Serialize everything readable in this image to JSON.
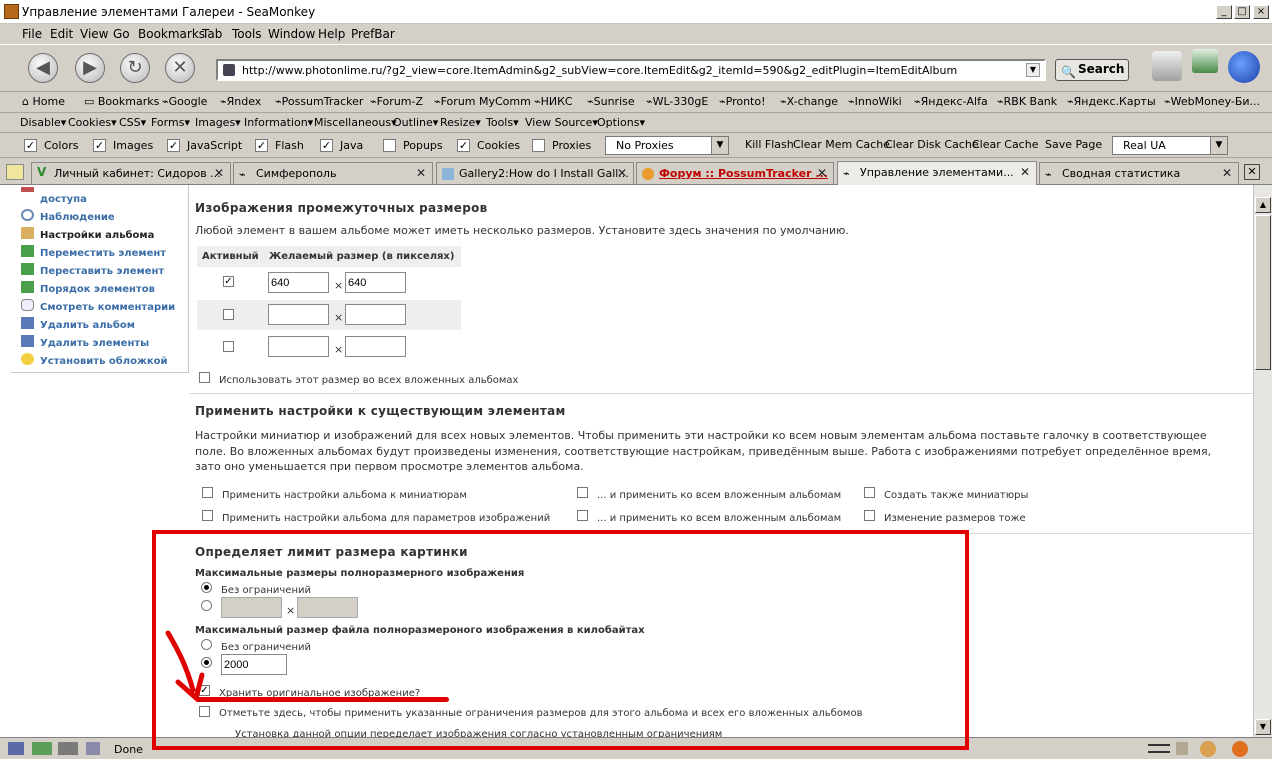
{
  "window": {
    "title": "Управление элементами Галереи - SeaMonkey"
  },
  "menu": [
    "File",
    "Edit",
    "View",
    "Go",
    "Bookmarks",
    "Tab",
    "Tools",
    "Window",
    "Help",
    "PrefBar"
  ],
  "nav": {
    "url": "http://www.photonlime.ru/?g2_view=core.ItemAdmin&g2_subView=core.ItemEdit&g2_itemId=590&g2_editPlugin=ItemEditAlbum",
    "search_label": "Search"
  },
  "bookmarks": [
    "Home",
    "Bookmarks",
    "Google",
    "Яndex",
    "PossumTracker",
    "Forum-Z",
    "Forum MyComm",
    "НИКС",
    "Sunrise",
    "WL-330gE",
    "Pronto!",
    "X-change",
    "InnoWiki",
    "Яндекс-Alfa",
    "RBK Bank",
    "Яндекс.Карты",
    "WebMoney-Би..."
  ],
  "devtools": [
    "Disable▾",
    "Cookies▾",
    "CSS▾",
    "Forms▾",
    "Images▾",
    "Information▾",
    "Miscellaneous▾",
    "Outline▾",
    "Resize▾",
    "Tools▾",
    "View Source▾",
    "Options▾"
  ],
  "prefbar": {
    "checks": [
      {
        "label": "Colors",
        "checked": true
      },
      {
        "label": "Images",
        "checked": true
      },
      {
        "label": "JavaScript",
        "checked": true
      },
      {
        "label": "Flash",
        "checked": true
      },
      {
        "label": "Java",
        "checked": true
      },
      {
        "label": "Popups",
        "checked": false
      },
      {
        "label": "Cookies",
        "checked": true
      },
      {
        "label": "Proxies",
        "checked": false
      }
    ],
    "proxy_select": "No Proxies",
    "buttons": [
      "Kill Flash",
      "Clear Mem Cache",
      "Clear Disk Cache",
      "Clear Cache",
      "Save Page"
    ],
    "ua_select": "Real UA"
  },
  "tabs": [
    {
      "label": "Личный кабинет: Сидоров ..."
    },
    {
      "label": "Симферополь"
    },
    {
      "label": "Gallery2:How do I Install Gall..."
    },
    {
      "label": "Форум :: PossumTracker ..."
    },
    {
      "label": "Управление элементами..."
    },
    {
      "label": "Сводная статистика"
    }
  ],
  "sidebar": {
    "items": [
      "доступа",
      "Наблюдение",
      "Настройки альбома",
      "Переместить элемент",
      "Переставить элемент",
      "Порядок элементов",
      "Смотреть комментарии",
      "Удалить альбом",
      "Удалить элементы",
      "Установить обложкой"
    ]
  },
  "sizes": {
    "title": "Изображения промежуточных размеров",
    "desc": "Любой элемент в вашем альбоме может иметь несколько размеров. Установите здесь значения по умолчанию.",
    "col_active": "Активный",
    "col_size": "Желаемый размер (в пикселях)",
    "rows": [
      {
        "checked": true,
        "w": "640",
        "h": "640"
      },
      {
        "checked": false,
        "w": "",
        "h": ""
      },
      {
        "checked": false,
        "w": "",
        "h": ""
      }
    ],
    "times": "×",
    "apply_sub": "Использовать этот размер во всех вложенных альбомах"
  },
  "apply": {
    "title": "Применить настройки к существующим элементам",
    "desc1": "Настройки миниатюр и изображений для всех новых элементов. Чтобы применить эти настройки ко всем новым элементам альбома поставьте галочку в соответствующее",
    "desc2": "поле. Во вложенных альбомах будут произведены изменения, соответствующие настройкам, приведённым выше. Работа с изображениями потребует определённое время,",
    "desc3": "зато оно уменьшается при первом просмотре элементов альбома.",
    "opt1": "Применить настройки альбома к миниатюрам",
    "opt2": "... и применить ко всем вложенным альбомам",
    "opt3": "Создать также миниатюры",
    "opt4": "Применить настройки альбома для параметров изображений",
    "opt5": "... и применить ко всем вложенным альбомам",
    "opt6": "Изменение размеров тоже"
  },
  "limit": {
    "title": "Определяет лимит размера картинки",
    "dims_label": "Максимальные размеры полноразмерного изображения",
    "no_limit": "Без ограничений",
    "times": "×",
    "file_label": "Максимальный размер файла полноразмероного изображения в килобайтах",
    "no_limit2": "Без ограничений",
    "file_value": "2000",
    "keep_original": "Хранить оригинальное изображение?",
    "apply_note": "Отметьте здесь, чтобы применить указанные ограничения размеров для этого альбома и всех его вложенных альбомов",
    "apply_note2": "Установка данной опции переделает изображения согласно установленным ограничениям"
  },
  "status": {
    "text": "Done"
  },
  "colors": {
    "annotation": "#e00000",
    "link": "#3b6ea8"
  }
}
